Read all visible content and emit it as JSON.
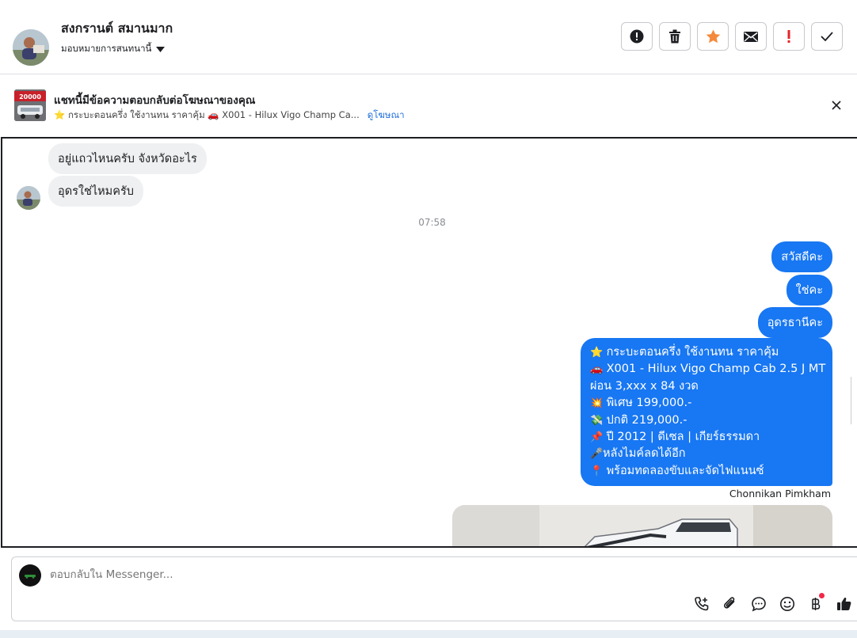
{
  "header": {
    "name": "สงกรานต์ สมานมาก",
    "assign_label": "มอบหมายการสนทนานี้",
    "toolbar": [
      "alert-icon",
      "trash-icon",
      "star-icon",
      "mail-icon",
      "priority-icon",
      "check-icon"
    ]
  },
  "ad": {
    "thumb_text": "20000",
    "title": "แชทนี้มีข้อความตอบกลับต่อโฆษณาของคุณ",
    "subtitle": "⭐ กระบะตอนครึ่ง ใช้งานทน ราคาคุ้ม 🚗 X001 - Hilux Vigo Champ Ca...",
    "link": "ดูโฆษณา"
  },
  "chat": {
    "incoming": [
      "อยู่แถวไหนครับ จังหวัดอะไร",
      "อุดรใช่ไหมครับ"
    ],
    "timestamp": "07:58",
    "outgoing": [
      "สวัสดีคะ",
      "ใช่คะ",
      "อุดรธานีคะ"
    ],
    "listing_lines": [
      {
        "emoji": "⭐",
        "text": "กระบะตอนครึ่ง ใช้งานทน ราคาคุ้ม"
      },
      {
        "emoji": "🚗",
        "text": "X001 - Hilux Vigo Champ Cab 2.5 J MT"
      },
      {
        "emoji": "",
        "text": "ผ่อน 3,xxx x 84 งวด"
      },
      {
        "emoji": "💥",
        "text": "พิเศษ 199,000.-"
      },
      {
        "emoji": "💸",
        "text": "ปกติ 219,000.-"
      },
      {
        "emoji": "📌",
        "text": "ปี 2012 | ดีเซล | เกียร์ธรรมดา"
      },
      {
        "emoji": "🎤",
        "text": "หลังไมค์ลดได้อีก"
      },
      {
        "emoji": "📍",
        "text": "พร้อมทดลองขับและจัดไฟแนนซ์"
      }
    ],
    "sender": "Chonnikan Pimkham"
  },
  "composer": {
    "placeholder": "ตอบกลับใน Messenger...",
    "icons": [
      "call-add-icon",
      "attachment-icon",
      "chat-bubble-icon",
      "emoji-icon",
      "baht-icon",
      "thumbs-up-icon"
    ]
  }
}
